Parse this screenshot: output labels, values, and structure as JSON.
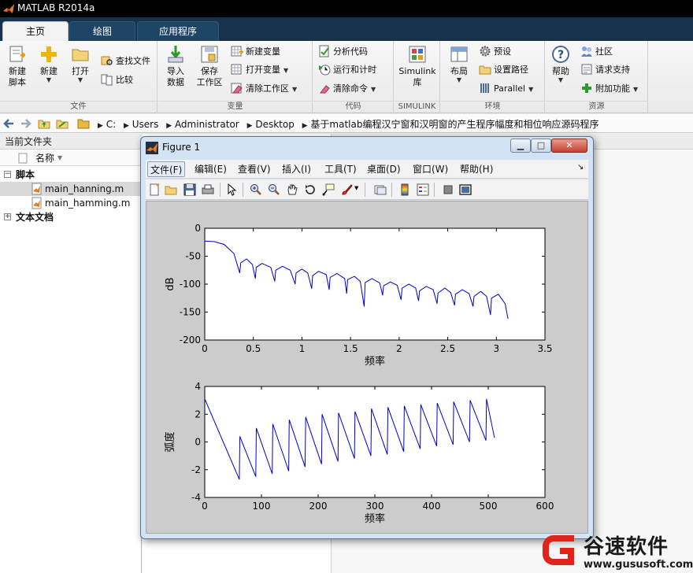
{
  "window": {
    "title": "MATLAB R2014a"
  },
  "tabs": [
    {
      "label": "主页",
      "active": true
    },
    {
      "label": "绘图",
      "active": false
    },
    {
      "label": "应用程序",
      "active": false
    }
  ],
  "ribbon": {
    "file": {
      "label": "文件",
      "new_script": "新建\n脚本",
      "new": "新建",
      "open": "打开",
      "find_files": "查找文件",
      "compare": "比较"
    },
    "variable": {
      "label": "变量",
      "import_data": "导入\n数据",
      "save_workspace": "保存\n工作区",
      "new_variable": "新建变量",
      "open_variable": "打开变量",
      "clear_workspace": "清除工作区"
    },
    "code": {
      "label": "代码",
      "analyze_code": "分析代码",
      "run_and_time": "运行和计时",
      "clear_commands": "清除命令"
    },
    "simulink": {
      "label": "SIMULINK",
      "library": "Simulink\n库"
    },
    "environment": {
      "label": "环境",
      "layout": "布局",
      "preferences": "预设",
      "set_path": "设置路径",
      "parallel": "Parallel"
    },
    "resources": {
      "label": "资源",
      "help": "帮助",
      "community": "社区",
      "request_support": "请求支持",
      "add_ons": "附加功能"
    }
  },
  "address": {
    "crumbs": [
      "C:",
      "Users",
      "Administrator",
      "Desktop",
      "基于matlab编程汉宁窗和汉明窗的产生程序幅度和相位响应源码程序"
    ]
  },
  "current_folder": {
    "title": "当前文件夹",
    "column_name": "名称",
    "groups": [
      {
        "label": "脚本",
        "files": [
          "main_hanning.m",
          "main_hamming.m"
        ]
      },
      {
        "label": "文本文档",
        "files": []
      }
    ],
    "selected_file": "main_hanning.m"
  },
  "figure": {
    "title": "Figure 1",
    "menus": [
      "文件(F)",
      "编辑(E)",
      "查看(V)",
      "插入(I)",
      "工具(T)",
      "桌面(D)",
      "窗口(W)",
      "帮助(H)"
    ],
    "active_menu": "文件(F)",
    "toolbar_icons": [
      "new-figure-icon",
      "open-file-icon",
      "save-icon",
      "print-icon",
      "pointer-icon",
      "zoom-in-icon",
      "zoom-out-icon",
      "pan-icon",
      "rotate-icon",
      "data-cursor-icon",
      "brush-icon",
      "link-icon",
      "colorbar-icon",
      "legend-icon",
      "hide-tools-icon",
      "show-tools-icon"
    ]
  },
  "colors": {
    "line": "#0000cc",
    "titlebar": "#000000",
    "tabstrip": "#17324c"
  },
  "chart_data": [
    {
      "type": "line",
      "title": "",
      "xlabel": "频率",
      "ylabel": "dB",
      "xlim": [
        0,
        3.5
      ],
      "ylim": [
        -200,
        0
      ],
      "xticks": [
        "0",
        "0.5",
        "1",
        "1.5",
        "2",
        "2.5",
        "3",
        "3.5"
      ],
      "yticks": [
        "0",
        "-50",
        "-100",
        "-150",
        "-200"
      ],
      "grid": false,
      "series": [
        {
          "x": [
            0,
            0.1,
            0.2,
            0.3,
            0.36,
            0.37,
            0.43,
            0.49,
            0.52,
            0.53,
            0.59,
            0.68,
            0.72,
            0.73,
            0.8,
            0.88,
            0.93,
            0.94,
            1.0,
            1.06,
            1.1,
            1.11,
            1.17,
            1.25,
            1.28,
            1.29,
            1.36,
            1.44,
            1.46,
            1.47,
            1.54,
            1.6,
            1.64,
            1.65,
            1.72,
            1.8,
            1.83,
            1.84,
            1.91,
            1.98,
            2.02,
            2.03,
            2.1,
            2.17,
            2.2,
            2.21,
            2.28,
            2.35,
            2.39,
            2.4,
            2.47,
            2.53,
            2.57,
            2.58,
            2.65,
            2.72,
            2.76,
            2.77,
            2.84,
            2.9,
            2.94,
            2.95,
            3.02,
            3.09,
            3.12
          ],
          "y": [
            -23,
            -24,
            -29,
            -45,
            -80,
            -62,
            -55,
            -65,
            -90,
            -70,
            -63,
            -70,
            -95,
            -75,
            -68,
            -75,
            -100,
            -80,
            -73,
            -80,
            -108,
            -85,
            -77,
            -83,
            -110,
            -88,
            -81,
            -90,
            -117,
            -92,
            -86,
            -95,
            -140,
            -97,
            -90,
            -98,
            -120,
            -103,
            -96,
            -102,
            -128,
            -107,
            -100,
            -107,
            -130,
            -112,
            -104,
            -110,
            -135,
            -116,
            -107,
            -115,
            -138,
            -118,
            -110,
            -117,
            -140,
            -122,
            -113,
            -122,
            -155,
            -125,
            -118,
            -135,
            -162
          ]
        }
      ]
    },
    {
      "type": "line",
      "title": "",
      "xlabel": "频率",
      "ylabel": "弧度",
      "xlim": [
        0,
        600
      ],
      "ylim": [
        -4,
        4
      ],
      "xticks": [
        "0",
        "100",
        "200",
        "300",
        "400",
        "500",
        "600"
      ],
      "yticks": [
        "4",
        "2",
        "0",
        "-2",
        "-4"
      ],
      "grid": false,
      "series": [
        {
          "x": [
            0,
            61,
            62,
            90,
            91,
            119,
            120,
            148,
            149,
            177,
            178,
            206,
            207,
            235,
            236,
            264,
            265,
            293,
            294,
            322,
            323,
            351,
            352,
            380,
            381,
            409,
            410,
            438,
            439,
            467,
            468,
            496,
            497,
            511
          ],
          "y": [
            3.1,
            -2.7,
            0.4,
            -2.5,
            1.0,
            -2.3,
            1.3,
            -2.1,
            1.6,
            -1.8,
            1.8,
            -1.6,
            2.0,
            -1.4,
            2.1,
            -1.2,
            2.2,
            -1.0,
            2.4,
            -0.9,
            2.5,
            -0.7,
            2.6,
            -0.5,
            2.7,
            -0.3,
            2.8,
            -0.2,
            2.9,
            0.0,
            3.0,
            0.1,
            3.1,
            0.3
          ]
        }
      ]
    }
  ],
  "watermark": {
    "brand": "谷速软件",
    "url": "www.gususoft.com"
  }
}
